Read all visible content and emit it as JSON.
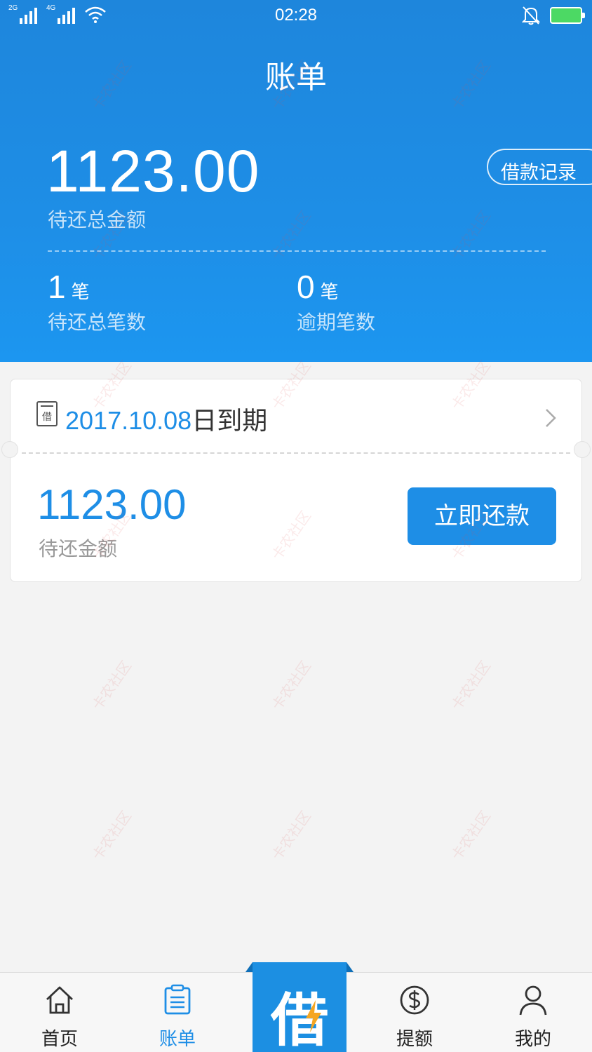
{
  "status": {
    "net1": "2G",
    "net2": "4G",
    "time": "02:28"
  },
  "header": {
    "title": "账单",
    "total_amount": "1123.00",
    "total_label": "待还总金额",
    "loan_record": "借款记录",
    "pending_count": "1",
    "pending_unit": "笔",
    "pending_label": "待还总笔数",
    "overdue_count": "0",
    "overdue_unit": "笔",
    "overdue_label": "逾期笔数"
  },
  "bill": {
    "due_date": "2017.10.08",
    "due_suffix": "日到期",
    "amount": "1123.00",
    "amount_label": "待还金额",
    "repay_label": "立即还款"
  },
  "tabs": {
    "home": "首页",
    "bill": "账单",
    "borrow": "借",
    "quota": "提额",
    "mine": "我的"
  },
  "watermark": "卡农社区",
  "colors": {
    "brand": "#1e8ee6",
    "battery": "#4cd964"
  }
}
